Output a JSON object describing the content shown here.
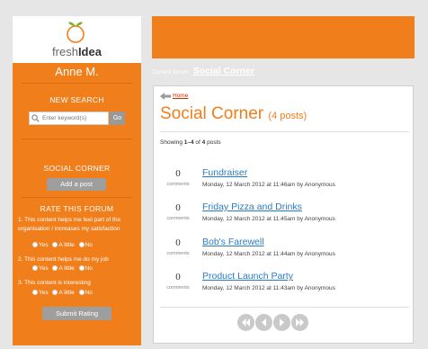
{
  "logo": {
    "text_light": "fresh",
    "text_bold": "Idea"
  },
  "user": {
    "name": "Anne M."
  },
  "search": {
    "title": "NEW SEARCH",
    "placeholder": "Enter keyword(s)",
    "go_label": "Go"
  },
  "social": {
    "title": "SOCIAL CORNER",
    "add_post_label": "Add a post"
  },
  "rate": {
    "title": "RATE THIS FORUM",
    "questions": [
      {
        "text": "1.  This content helps me feel part of the organisation / increases my satisfaction"
      },
      {
        "text": "2.  This content helps me do my job"
      },
      {
        "text": "3.  This content is interesting"
      }
    ],
    "options": [
      "Yes",
      "A little",
      "No"
    ],
    "submit_label": "Submit Rating"
  },
  "header": {
    "forum_prefix": "Current forum:",
    "forum_name": "Social Corner"
  },
  "main": {
    "home_link": "Home",
    "title": "Social Corner",
    "post_count_label": "(4 posts)",
    "showing": {
      "prefix": "Showing ",
      "range": "1–4",
      "middle": " of ",
      "total": "4",
      "suffix": " posts"
    },
    "posts": [
      {
        "count": "0",
        "comments_label": "comments",
        "title": "Fundraiser",
        "meta": "Monday, 12 March 2012 at 11:46am by Anonymous"
      },
      {
        "count": "0",
        "comments_label": "comments",
        "title": "Friday Pizza and Drinks",
        "meta": "Monday, 12 March 2012 at 11:45am by Anonymous"
      },
      {
        "count": "0",
        "comments_label": "comments",
        "title": "Bob's Farewell",
        "meta": "Monday, 12 March 2012 at 11:44am by Anonymous"
      },
      {
        "count": "0",
        "comments_label": "comments",
        "title": "Product Launch Party",
        "meta": "Monday, 12 March 2012 at 11:43am by Anonymous"
      }
    ]
  },
  "colors": {
    "brand_orange": "#f07e1b",
    "link_blue": "#2a7bc6",
    "home_red": "#cc3300"
  },
  "icons": [
    "logo-apple-icon",
    "search-icon",
    "back-arrow-icon",
    "first-page-icon",
    "previous-page-icon",
    "next-page-icon",
    "last-page-icon"
  ]
}
